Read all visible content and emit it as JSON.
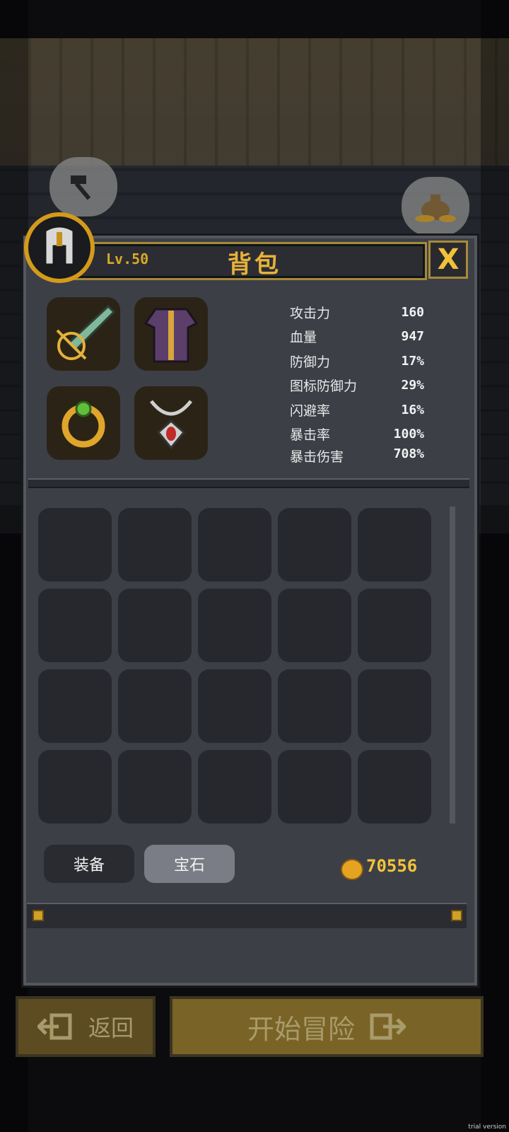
{
  "panel": {
    "level": "Lv.50",
    "title": "背包",
    "close_label": "X"
  },
  "equipment": [
    {
      "slot": "weapon",
      "icon": "sword-icon"
    },
    {
      "slot": "armor",
      "icon": "armor-icon"
    },
    {
      "slot": "ring",
      "icon": "ring-icon"
    },
    {
      "slot": "necklace",
      "icon": "necklace-icon"
    }
  ],
  "stats": [
    {
      "label": "攻击力",
      "value": "160"
    },
    {
      "label": "血量",
      "value": "947"
    },
    {
      "label": "防御力",
      "value": "17%"
    },
    {
      "label": "图标防御力",
      "value": "29%"
    },
    {
      "label": "闪避率",
      "value": "16%"
    },
    {
      "label": "暴击率",
      "value": "100%"
    },
    {
      "label": "暴击伤害",
      "value": "708%"
    }
  ],
  "tabs": {
    "equipment": "装备",
    "gems": "宝石"
  },
  "currency": {
    "gold": "70556"
  },
  "footer": {
    "back": "返回",
    "start": "开始冒险"
  },
  "watermark": "trial version",
  "colors": {
    "accent": "#e7b23a",
    "panel": "#3d3f47"
  }
}
